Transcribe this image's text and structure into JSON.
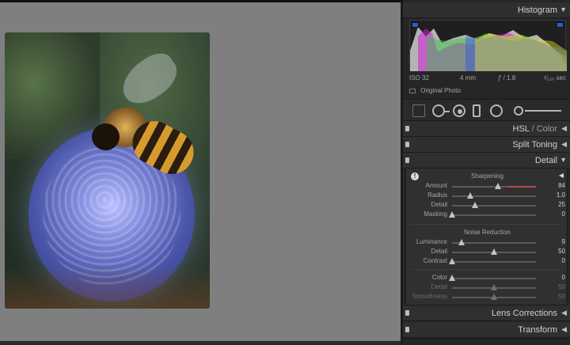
{
  "panel": {
    "histogram": {
      "title": "Histogram",
      "exif": {
        "iso": "ISO 32",
        "focal": "4 mm",
        "aperture": "ƒ / 1.8",
        "shutter": "¹⁄₁₂₀ sec"
      },
      "original_photo_label": "Original Photo"
    },
    "sections": {
      "hsl": {
        "title": "HSL",
        "sep": " / ",
        "sub": "Color"
      },
      "split_toning": "Split Toning",
      "detail": "Detail",
      "lens_corrections": "Lens Corrections",
      "transform": "Transform"
    },
    "detail": {
      "sharpening_title": "Sharpening",
      "sharpening": [
        {
          "label": "Amount",
          "value": "84",
          "position": 0.55
        },
        {
          "label": "Radius",
          "value": "1.0",
          "position": 0.22
        },
        {
          "label": "Detail",
          "value": "25",
          "position": 0.27
        },
        {
          "label": "Masking",
          "value": "0",
          "position": 0.0
        }
      ],
      "noise_title": "Noise Reduction",
      "noise": [
        {
          "label": "Luminance",
          "value": "9",
          "position": 0.11
        },
        {
          "label": "Detail",
          "value": "50",
          "position": 0.5
        },
        {
          "label": "Contrast",
          "value": "0",
          "position": 0.0
        },
        {
          "label": "Color",
          "value": "0",
          "position": 0.0
        },
        {
          "label": "Detail",
          "value": "50",
          "position": 0.5
        },
        {
          "label": "Smoothness",
          "value": "50",
          "position": 0.5
        }
      ]
    }
  },
  "icons": [
    "grid-icon",
    "spot-removal-icon",
    "redeye-icon",
    "graduated-filter-icon",
    "radial-filter-icon",
    "adjustment-brush-icon"
  ]
}
